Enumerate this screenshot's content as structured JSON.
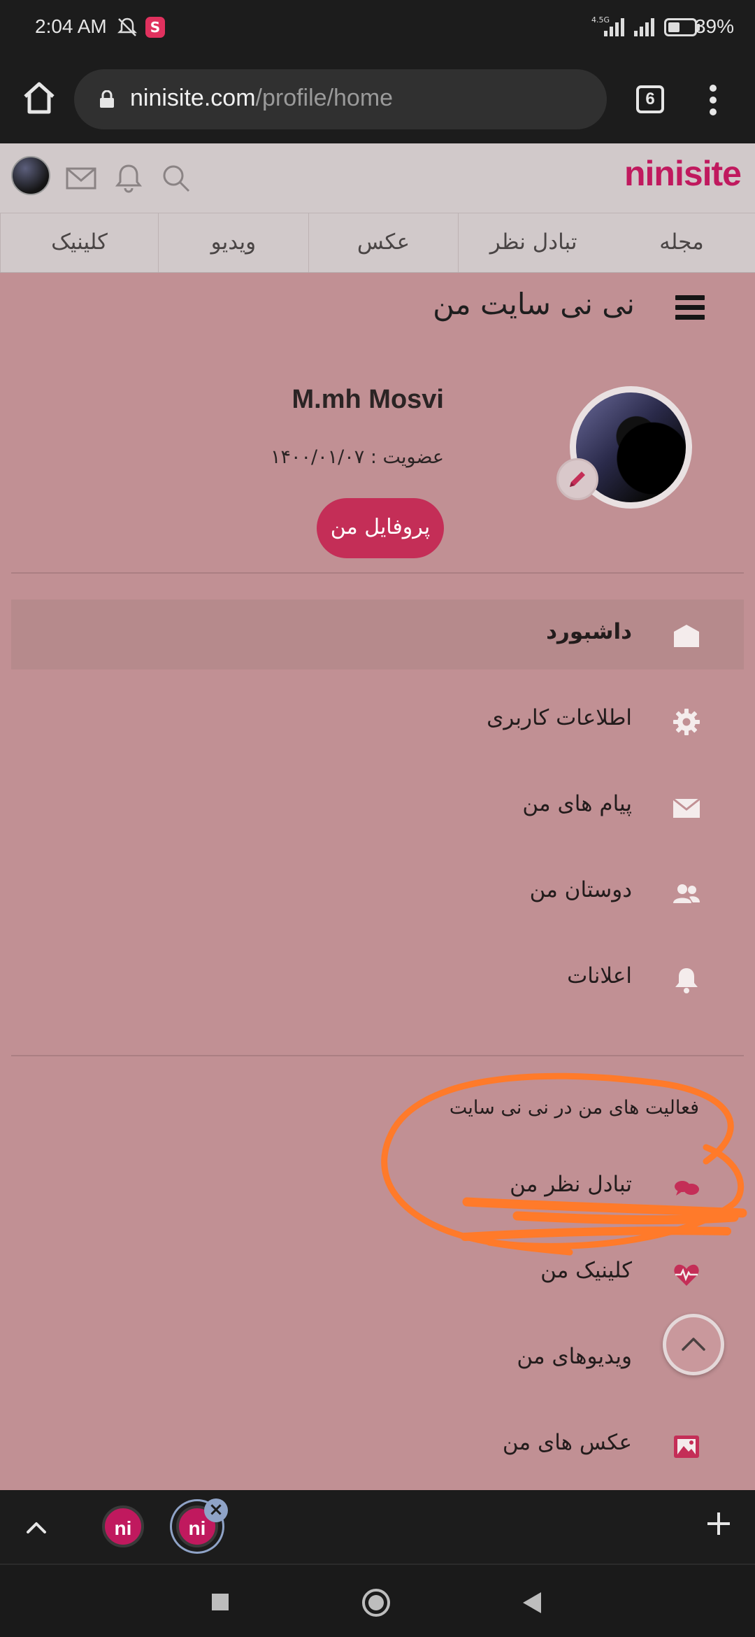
{
  "status_bar": {
    "time": "2:04 AM",
    "network_label": "4.5G",
    "battery_percent": "39%"
  },
  "browser": {
    "url_host": "ninisite.com",
    "url_path": "/profile/home",
    "tab_count": "6"
  },
  "site": {
    "logo": "ninisite",
    "nav": [
      "مجله",
      "تبادل نظر",
      "عکس",
      "ویدیو",
      "کلینیک"
    ]
  },
  "profile": {
    "site_title": "نی نی سایت من",
    "name": "M.mh Mosvi",
    "member_since": "عضویت : ۱۴۰۰/۰۱/۰۷",
    "profile_button": "پروفایل من"
  },
  "menu": [
    {
      "label": "داشبورد",
      "icon": "home-icon",
      "active": true
    },
    {
      "label": "اطلاعات کاربری",
      "icon": "gear-icon",
      "active": false
    },
    {
      "label": "پیام های من",
      "icon": "envelope-icon",
      "active": false
    },
    {
      "label": "دوستان من",
      "icon": "friends-icon",
      "active": false
    },
    {
      "label": "اعلانات",
      "icon": "bell-icon",
      "active": false
    }
  ],
  "activities": {
    "title": "فعالیت های من در نی نی سایت",
    "items": [
      {
        "label": "تبادل نظر من",
        "icon": "chat-bubbles-icon"
      },
      {
        "label": "کلینیک من",
        "icon": "heart-pulse-icon"
      },
      {
        "label": "ویدیوهای من",
        "icon": "video-icon"
      },
      {
        "label": "عکس های من",
        "icon": "image-icon"
      }
    ]
  },
  "tab_strip": {
    "tab_label": "ni"
  },
  "colors": {
    "brand": "#c0195e",
    "page_bg": "#c19094",
    "button": "#c42e57",
    "annotation": "#ff7a2a"
  }
}
